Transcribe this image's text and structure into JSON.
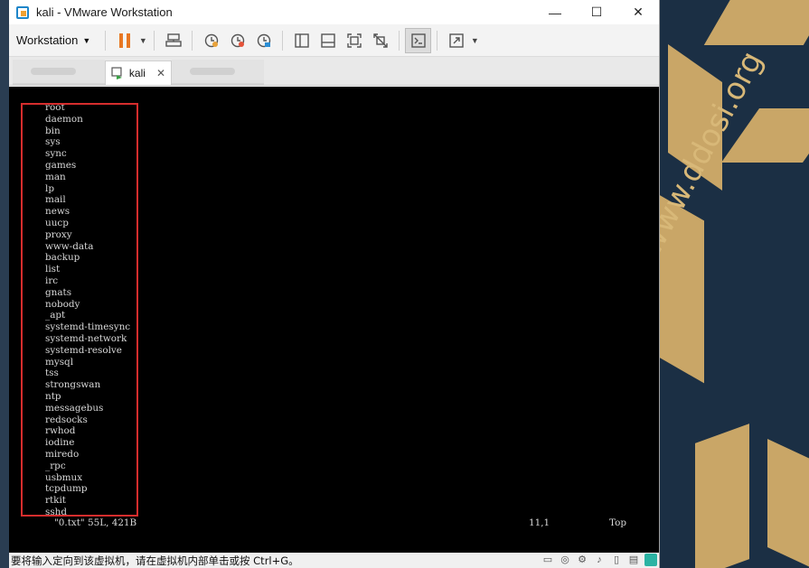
{
  "window": {
    "title": "kali - VMware Workstation",
    "minimize": "—",
    "maximize": "☐",
    "close": "✕"
  },
  "toolbar": {
    "workstation_menu": "Workstation"
  },
  "tabs": [
    {
      "label": "kali"
    }
  ],
  "console": {
    "lines": [
      "root",
      "daemon",
      "bin",
      "sys",
      "sync",
      "games",
      "man",
      "lp",
      "mail",
      "news",
      "uucp",
      "proxy",
      "www-data",
      "backup",
      "list",
      "irc",
      "gnats",
      "nobody",
      "_apt",
      "systemd-timesync",
      "systemd-network",
      "systemd-resolve",
      "mysql",
      "tss",
      "strongswan",
      "ntp",
      "messagebus",
      "redsocks",
      "rwhod",
      "iodine",
      "miredo",
      "_rpc",
      "usbmux",
      "tcpdump",
      "rtkit",
      "sshd"
    ],
    "status_file": "\"0.txt\" 55L, 421B",
    "status_pos": "11,1",
    "status_scroll": "Top"
  },
  "statusbar": {
    "message": "要将输入定向到该虚拟机，请在虚拟机内部单击或按 Ctrl+G。"
  },
  "desktop": {
    "watermark": "www.ddosi.org"
  },
  "colors": {
    "accent_pause": "#e87722",
    "selection_box": "#d62d2d",
    "console_bg": "#000000"
  }
}
